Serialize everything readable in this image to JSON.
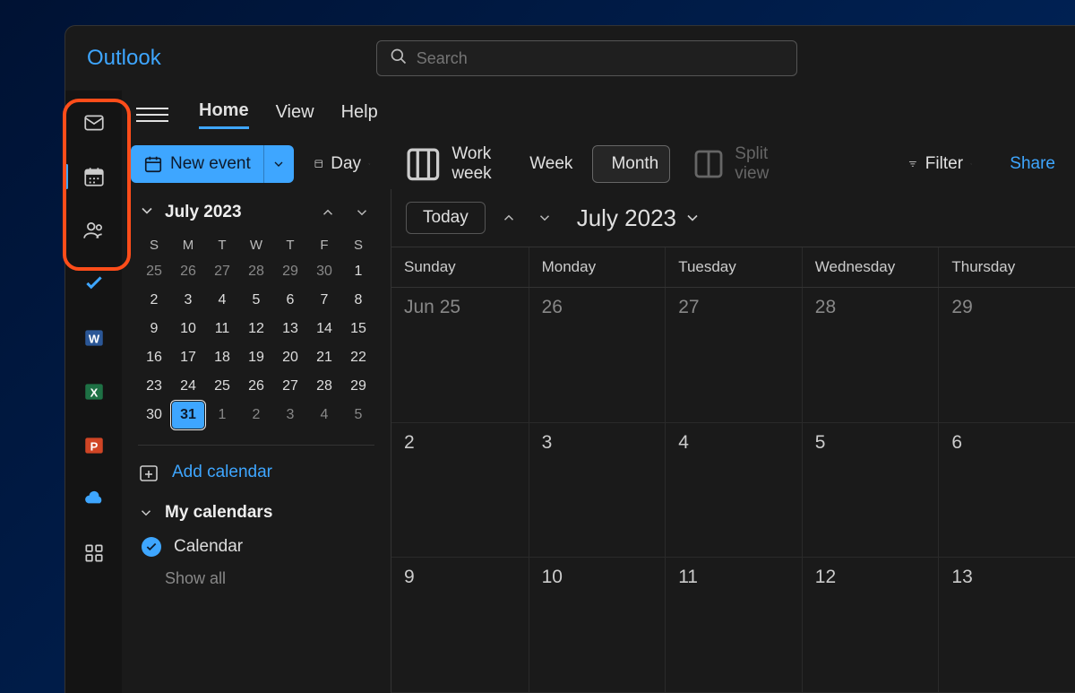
{
  "app": {
    "title": "Outlook"
  },
  "search": {
    "placeholder": "Search"
  },
  "rail": [
    {
      "name": "mail-icon",
      "active": false
    },
    {
      "name": "calendar-icon",
      "active": true
    },
    {
      "name": "people-icon",
      "active": false
    },
    {
      "name": "todo-icon",
      "active": false
    },
    {
      "name": "word-icon",
      "active": false
    },
    {
      "name": "excel-icon",
      "active": false
    },
    {
      "name": "powerpoint-icon",
      "active": false
    },
    {
      "name": "onedrive-icon",
      "active": false
    },
    {
      "name": "apps-icon",
      "active": false
    }
  ],
  "tabs": {
    "home": "Home",
    "view": "View",
    "help": "Help",
    "active": "home"
  },
  "toolbar": {
    "new_event": "New event",
    "day": "Day",
    "work_week": "Work week",
    "week": "Week",
    "month": "Month",
    "split_view": "Split view",
    "filter": "Filter",
    "share": "Share",
    "active_view": "month"
  },
  "mini": {
    "label": "July 2023",
    "dow": [
      "S",
      "M",
      "T",
      "W",
      "T",
      "F",
      "S"
    ],
    "days": [
      {
        "n": "25",
        "other": true
      },
      {
        "n": "26",
        "other": true
      },
      {
        "n": "27",
        "other": true
      },
      {
        "n": "28",
        "other": true
      },
      {
        "n": "29",
        "other": true
      },
      {
        "n": "30",
        "other": true
      },
      {
        "n": "1"
      },
      {
        "n": "2"
      },
      {
        "n": "3"
      },
      {
        "n": "4"
      },
      {
        "n": "5"
      },
      {
        "n": "6"
      },
      {
        "n": "7"
      },
      {
        "n": "8"
      },
      {
        "n": "9"
      },
      {
        "n": "10"
      },
      {
        "n": "11"
      },
      {
        "n": "12"
      },
      {
        "n": "13"
      },
      {
        "n": "14"
      },
      {
        "n": "15"
      },
      {
        "n": "16"
      },
      {
        "n": "17"
      },
      {
        "n": "18"
      },
      {
        "n": "19"
      },
      {
        "n": "20"
      },
      {
        "n": "21"
      },
      {
        "n": "22"
      },
      {
        "n": "23"
      },
      {
        "n": "24"
      },
      {
        "n": "25"
      },
      {
        "n": "26"
      },
      {
        "n": "27"
      },
      {
        "n": "28"
      },
      {
        "n": "29"
      },
      {
        "n": "30"
      },
      {
        "n": "31",
        "selected": true
      },
      {
        "n": "1",
        "other": true
      },
      {
        "n": "2",
        "other": true
      },
      {
        "n": "3",
        "other": true
      },
      {
        "n": "4",
        "other": true
      },
      {
        "n": "5",
        "other": true
      }
    ]
  },
  "sidebar": {
    "add_calendar": "Add calendar",
    "group": "My calendars",
    "calendar_item": "Calendar",
    "show_all": "Show all"
  },
  "calview": {
    "today": "Today",
    "title": "July 2023",
    "columns": [
      "Sunday",
      "Monday",
      "Tuesday",
      "Wednesday",
      "Thursday"
    ],
    "cells": [
      {
        "t": "Jun 25",
        "other": true
      },
      {
        "t": "26",
        "other": true
      },
      {
        "t": "27",
        "other": true
      },
      {
        "t": "28",
        "other": true
      },
      {
        "t": "29",
        "other": true
      },
      {
        "t": "2"
      },
      {
        "t": "3"
      },
      {
        "t": "4"
      },
      {
        "t": "5"
      },
      {
        "t": "6"
      },
      {
        "t": "9"
      },
      {
        "t": "10"
      },
      {
        "t": "11"
      },
      {
        "t": "12"
      },
      {
        "t": "13"
      }
    ]
  }
}
